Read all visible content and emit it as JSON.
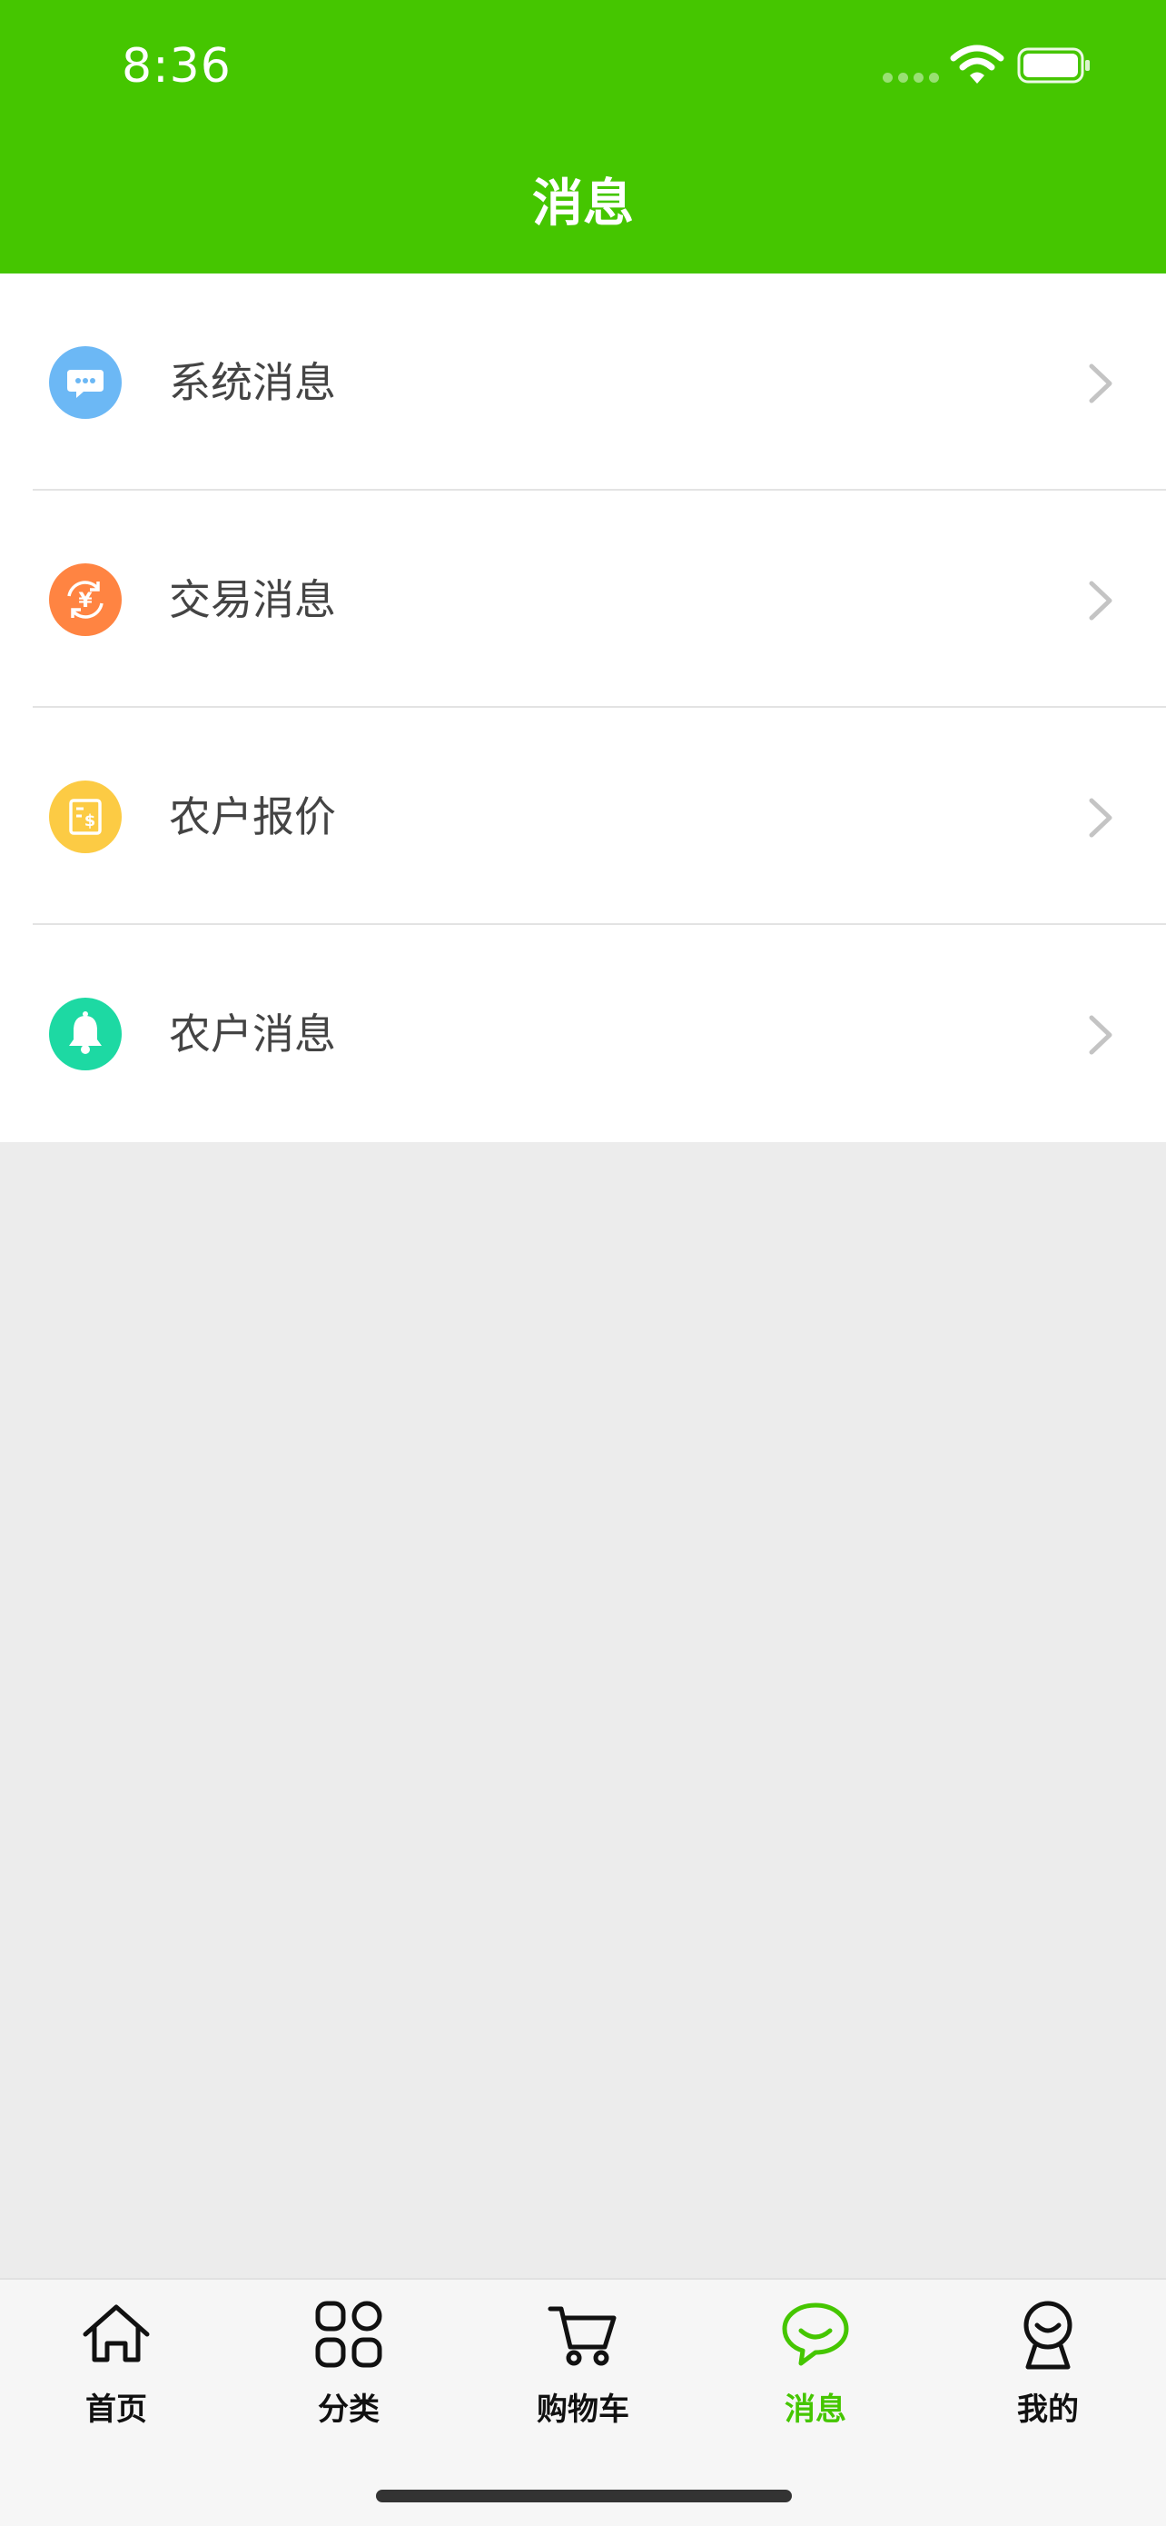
{
  "status_bar": {
    "time": "8:36"
  },
  "header": {
    "title": "消息"
  },
  "colors": {
    "brand": "#45c600",
    "system_icon": "#6cb8f5",
    "trade_icon": "#ff8442",
    "quote_icon": "#fccb44",
    "farmer_icon": "#1dd9a3"
  },
  "list": {
    "items": [
      {
        "label": "系统消息",
        "icon": "chat-bubble-icon"
      },
      {
        "label": "交易消息",
        "icon": "yuan-exchange-icon"
      },
      {
        "label": "农户报价",
        "icon": "price-document-icon"
      },
      {
        "label": "农户消息",
        "icon": "bell-icon"
      }
    ]
  },
  "tabbar": {
    "active": "消息",
    "items": [
      {
        "label": "首页",
        "icon": "home-icon"
      },
      {
        "label": "分类",
        "icon": "grid-icon"
      },
      {
        "label": "购物车",
        "icon": "cart-icon"
      },
      {
        "label": "消息",
        "icon": "message-icon"
      },
      {
        "label": "我的",
        "icon": "profile-icon"
      }
    ]
  }
}
